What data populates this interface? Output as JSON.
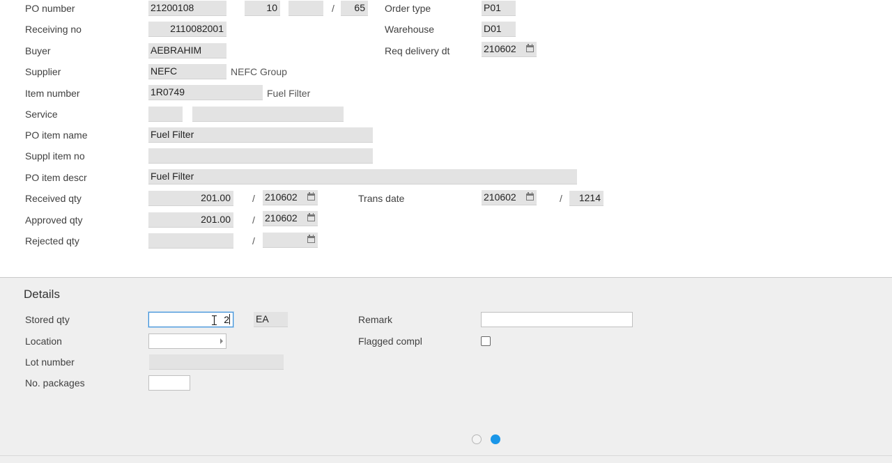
{
  "header": {
    "po_number": {
      "label": "PO number",
      "value": "21200108",
      "line": "10",
      "seq": "",
      "sep": "/",
      "sub": "65"
    },
    "receiving_no": {
      "label": "Receiving no",
      "value": "2110082001"
    },
    "buyer": {
      "label": "Buyer",
      "value": "AEBRAHIM"
    },
    "supplier": {
      "label": "Supplier",
      "value": "NEFC",
      "name": "NEFC Group"
    },
    "item_number": {
      "label": "Item number",
      "value": "1R0749",
      "name": "Fuel Filter"
    },
    "service": {
      "label": "Service",
      "value": "",
      "name": ""
    },
    "po_item_name": {
      "label": "PO item name",
      "value": "Fuel Filter"
    },
    "suppl_item_no": {
      "label": "Suppl item no",
      "value": ""
    },
    "po_item_descr": {
      "label": "PO item descr",
      "value": "Fuel Filter"
    },
    "received_qty": {
      "label": "Received qty",
      "value": "201.00",
      "sep": "/",
      "date": "210602"
    },
    "approved_qty": {
      "label": "Approved qty",
      "value": "201.00",
      "sep": "/",
      "date": "210602"
    },
    "rejected_qty": {
      "label": "Rejected qty",
      "value": "",
      "sep": "/",
      "date": ""
    },
    "order_type": {
      "label": "Order type",
      "value": "P01"
    },
    "warehouse": {
      "label": "Warehouse",
      "value": "D01"
    },
    "req_delivery_dt": {
      "label": "Req delivery dt",
      "value": "210602"
    },
    "trans_date": {
      "label": "Trans date",
      "value": "210602",
      "sep": "/",
      "time": "1214"
    }
  },
  "details": {
    "title": "Details",
    "stored_qty": {
      "label": "Stored qty",
      "value": "2",
      "unit": "EA"
    },
    "location": {
      "label": "Location",
      "value": ""
    },
    "lot_number": {
      "label": "Lot number",
      "value": ""
    },
    "no_packages": {
      "label": "No. packages",
      "value": ""
    },
    "remark": {
      "label": "Remark",
      "value": ""
    },
    "flagged_compl": {
      "label": "Flagged compl",
      "checked": false
    }
  },
  "pager": {
    "pages": 2,
    "active": 2
  },
  "colors": {
    "active_dot": "#1a96e8",
    "field_bg": "#e3e3e3",
    "panel_bg": "#efefef"
  }
}
